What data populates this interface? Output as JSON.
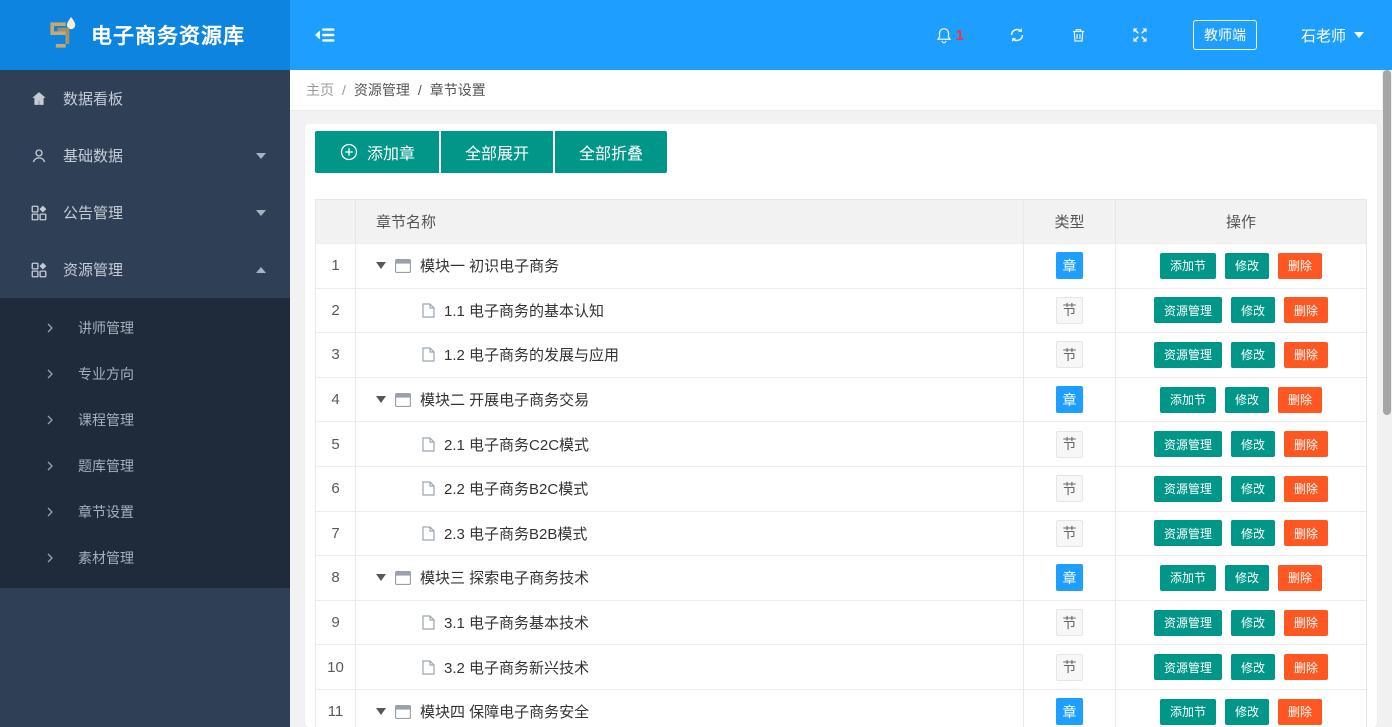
{
  "header": {
    "title": "电子商务资源库",
    "notification_count": "1",
    "role_badge": "教师端",
    "username": "石老师"
  },
  "sidebar": {
    "items": [
      {
        "label": "数据看板",
        "icon": "home-icon",
        "state": "none"
      },
      {
        "label": "基础数据",
        "icon": "user-icon",
        "state": "collapsed"
      },
      {
        "label": "公告管理",
        "icon": "app-icon",
        "state": "collapsed"
      },
      {
        "label": "资源管理",
        "icon": "app-icon",
        "state": "expanded"
      }
    ],
    "submenu": [
      {
        "label": "讲师管理"
      },
      {
        "label": "专业方向"
      },
      {
        "label": "课程管理"
      },
      {
        "label": "题库管理"
      },
      {
        "label": "章节设置"
      },
      {
        "label": "素材管理"
      }
    ]
  },
  "breadcrumb": {
    "home": "主页",
    "separator": "/",
    "section": "资源管理",
    "page": "章节设置"
  },
  "toolbar": {
    "add_chapter": "添加章",
    "expand_all": "全部展开",
    "collapse_all": "全部折叠"
  },
  "table": {
    "headers": {
      "index": "",
      "name": "章节名称",
      "type": "类型",
      "ops": "操作"
    },
    "type_labels": {
      "chapter": "章",
      "section": "节"
    },
    "op_labels": {
      "add_section": "添加节",
      "resource_manage": "资源管理",
      "edit": "修改",
      "delete": "删除"
    },
    "rows": [
      {
        "no": "1",
        "name": "模块一 初识电子商务",
        "kind": "chapter"
      },
      {
        "no": "2",
        "name": "1.1 电子商务的基本认知",
        "kind": "section"
      },
      {
        "no": "3",
        "name": "1.2 电子商务的发展与应用",
        "kind": "section"
      },
      {
        "no": "4",
        "name": "模块二 开展电子商务交易",
        "kind": "chapter"
      },
      {
        "no": "5",
        "name": "2.1 电子商务C2C模式",
        "kind": "section"
      },
      {
        "no": "6",
        "name": "2.2 电子商务B2C模式",
        "kind": "section"
      },
      {
        "no": "7",
        "name": "2.3 电子商务B2B模式",
        "kind": "section"
      },
      {
        "no": "8",
        "name": "模块三 探索电子商务技术",
        "kind": "chapter"
      },
      {
        "no": "9",
        "name": "3.1 电子商务基本技术",
        "kind": "section"
      },
      {
        "no": "10",
        "name": "3.2 电子商务新兴技术",
        "kind": "section"
      },
      {
        "no": "11",
        "name": "模块四 保障电子商务安全",
        "kind": "chapter"
      }
    ]
  },
  "colors": {
    "header_blue": "#1E9FFF",
    "logo_blue": "#0D84E0",
    "sidebar_bg": "#2F4056",
    "submenu_bg": "#1F2B3B",
    "teal": "#009688",
    "orange": "#FF5722",
    "chapter_badge_blue": "#1E9FFF",
    "notification_red": "#FF3030",
    "logo_gold": "#C9A86B"
  }
}
